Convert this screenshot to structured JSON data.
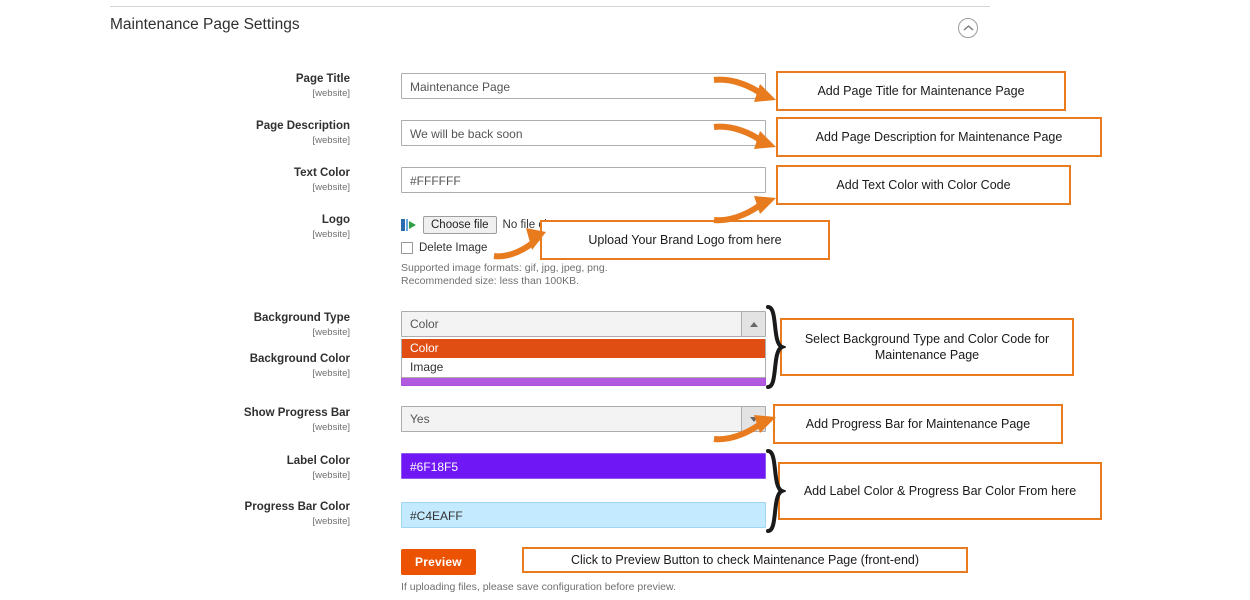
{
  "section": {
    "title": "Maintenance Page Settings",
    "collapse_icon": "chevron-up-circle-icon"
  },
  "scope_label": "[website]",
  "fields": [
    {
      "label": "Page Title",
      "scope": "[website]",
      "value": "Maintenance Page"
    },
    {
      "label": "Page Description",
      "scope": "[website]",
      "value": "We will be back soon"
    },
    {
      "label": "Text Color",
      "scope": "[website]",
      "value": "#FFFFFF"
    },
    {
      "label": "Logo",
      "scope": "[website]"
    },
    {
      "label": "Background Type",
      "scope": "[website]",
      "value": "Color"
    },
    {
      "label": "Background Color",
      "scope": "[website]",
      "value": ""
    },
    {
      "label": "Show Progress Bar",
      "scope": "[website]",
      "value": "Yes"
    },
    {
      "label": "Label Color",
      "scope": "[website]",
      "value": "#6F18F5"
    },
    {
      "label": "Progress Bar Color",
      "scope": "[website]",
      "value": "#C4EAFF"
    }
  ],
  "logo": {
    "choose_file_label": "Choose file",
    "no_file_text": "No file chosen",
    "delete_image_label": "Delete Image",
    "note_line1": "Supported image formats: gif, jpg, jpeg, png.",
    "note_line2": "Recommended size: less than 100KB."
  },
  "background_type": {
    "selected": "Color",
    "options": [
      "Color",
      "Image"
    ]
  },
  "preview": {
    "button_label": "Preview",
    "note": "If uploading files, please save configuration before preview."
  },
  "colors": {
    "accent_orange": "#e87b1e",
    "button_orange": "#eb5202",
    "dropdown_highlight": "#e04e13",
    "label_color_value": "#6F18F5",
    "progress_bar_color_value": "#C4EAFF"
  },
  "annotations": [
    {
      "text": "Add Page Title for Maintenance Page"
    },
    {
      "text": "Add Page Description for Maintenance Page"
    },
    {
      "text": "Add Text Color with Color Code"
    },
    {
      "text": "Upload Your Brand Logo from here"
    },
    {
      "text": "Select Background Type and Color Code for Maintenance Page"
    },
    {
      "text": "Add Progress Bar for Maintenance Page"
    },
    {
      "text": "Add Label Color & Progress Bar Color From here"
    },
    {
      "text": "Click to Preview Button to check Maintenance Page (front-end)"
    }
  ]
}
